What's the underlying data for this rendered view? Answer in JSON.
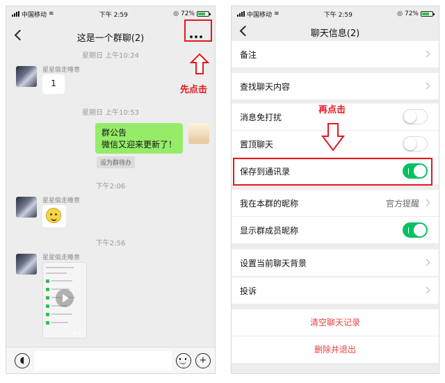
{
  "colors": {
    "annotation_red": "#e4161f",
    "wechat_green": "#07c160",
    "bubble_green": "#95ec69"
  },
  "statusbar": {
    "carrier": "中国移动",
    "time": "下午 2:59",
    "battery": "72%"
  },
  "chat": {
    "title": "这是一个群聊(2)",
    "timestamps": [
      "星期日 上午10:24",
      "星期日 上午10:53",
      "下午2:06",
      "下午2:56"
    ],
    "sender_name": "星星偷走睡意",
    "messages": {
      "msg1": "1",
      "announce_line1": "群公告",
      "announce_line2": "微信又迎来更新了！",
      "todo_tag": "设为群待办"
    },
    "video_duration": "0:07",
    "icons": [
      "voice-icon",
      "emoji-icon",
      "plus-icon",
      "more-icon",
      "back-icon"
    ]
  },
  "info": {
    "title": "聊天信息(2)",
    "rows": {
      "remark": "备注",
      "search": "查找聊天内容",
      "mute": "消息免打扰",
      "pin": "置顶聊天",
      "save_contacts": "保存到通讯录",
      "my_nickname": "我在本群的昵称",
      "my_nickname_value": "官方提醒",
      "show_nicknames": "显示群成员昵称",
      "background": "设置当前聊天背景",
      "complain": "投诉"
    },
    "toggles": {
      "mute": false,
      "pin": false,
      "save_contacts": true,
      "show_nicknames": true
    },
    "clear_history": "清空聊天记录",
    "delete_exit": "删除并退出"
  },
  "annotations": {
    "first_click": "先点击",
    "then_click": "再点击"
  }
}
